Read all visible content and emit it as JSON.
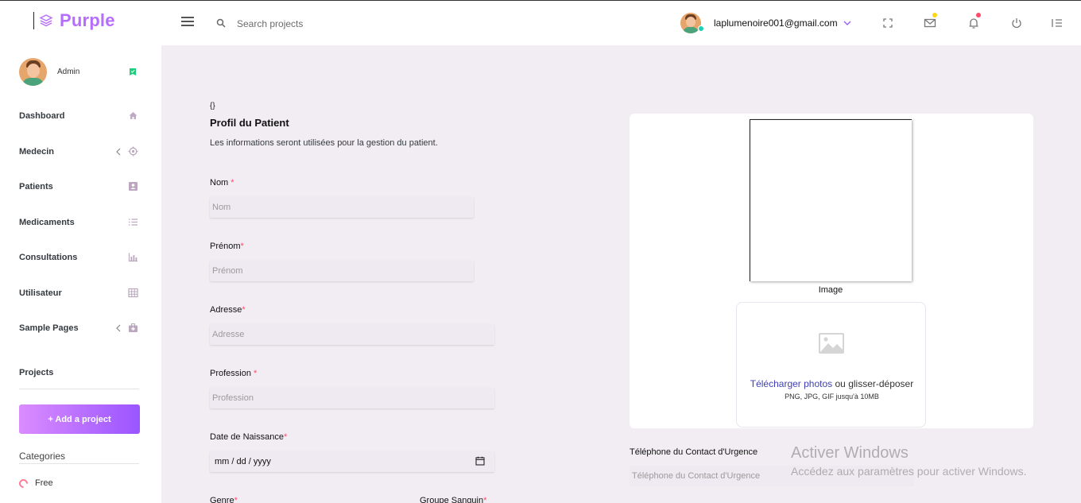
{
  "brand": {
    "name": "Purple"
  },
  "search": {
    "placeholder": "Search projects"
  },
  "user": {
    "email": "laplumenoire001@gmail.com"
  },
  "colors": {
    "accent": "#b66dff",
    "gradient_start": "#da8cff",
    "gradient_end": "#9a55ff",
    "required": "#fe4a6b",
    "background": "#f2edf3",
    "mail_dot": "#fed713",
    "bell_dot": "#fe4a6b",
    "online": "#1bcfb4"
  },
  "sidebar": {
    "profile_name": "Admin",
    "items": [
      {
        "label": "Dashboard",
        "icon": "home-icon"
      },
      {
        "label": "Medecin",
        "icon": "crosshairs-icon"
      },
      {
        "label": "Patients",
        "icon": "contacts-icon"
      },
      {
        "label": "Medicaments",
        "icon": "format-list-icon"
      },
      {
        "label": "Consultations",
        "icon": "chart-bar-icon"
      },
      {
        "label": "Utilisateur",
        "icon": "table-icon"
      },
      {
        "label": "Sample Pages",
        "icon": "medical-bag-icon"
      }
    ],
    "projects_title": "Projects",
    "add_project_label": "+ Add a project",
    "categories_title": "Categories",
    "categories": [
      {
        "label": "Free"
      }
    ]
  },
  "form": {
    "braces": "{}",
    "title": "Profil du Patient",
    "description": "Les informations seront utilisées pour la gestion du patient.",
    "nom_label": "Nom ",
    "nom_placeholder": "Nom",
    "prenom_label": "Prénom",
    "prenom_placeholder": "Prénom",
    "adresse_label": "Adresse",
    "adresse_placeholder": "Adresse",
    "profession_label": "Profession ",
    "profession_placeholder": "Profession",
    "date_label": "Date de Naissance",
    "date_value": "mm / dd / yyyy",
    "genre_label": "Genre",
    "groupe_label": "Groupe Sanguin",
    "required_mark": "*"
  },
  "image_card": {
    "caption": "Image",
    "upload_link": "Télécharger photos",
    "upload_text": " ou glisser-déposer",
    "upload_hint": "PNG, JPG, GIF jusqu'à 10MB"
  },
  "emergency": {
    "label": "Téléphone du Contact d'Urgence",
    "placeholder": "Téléphone du Contact d'Urgence"
  },
  "watermark": {
    "title": "Activer Windows",
    "subtitle": "Accédez aux paramètres pour activer Windows."
  }
}
